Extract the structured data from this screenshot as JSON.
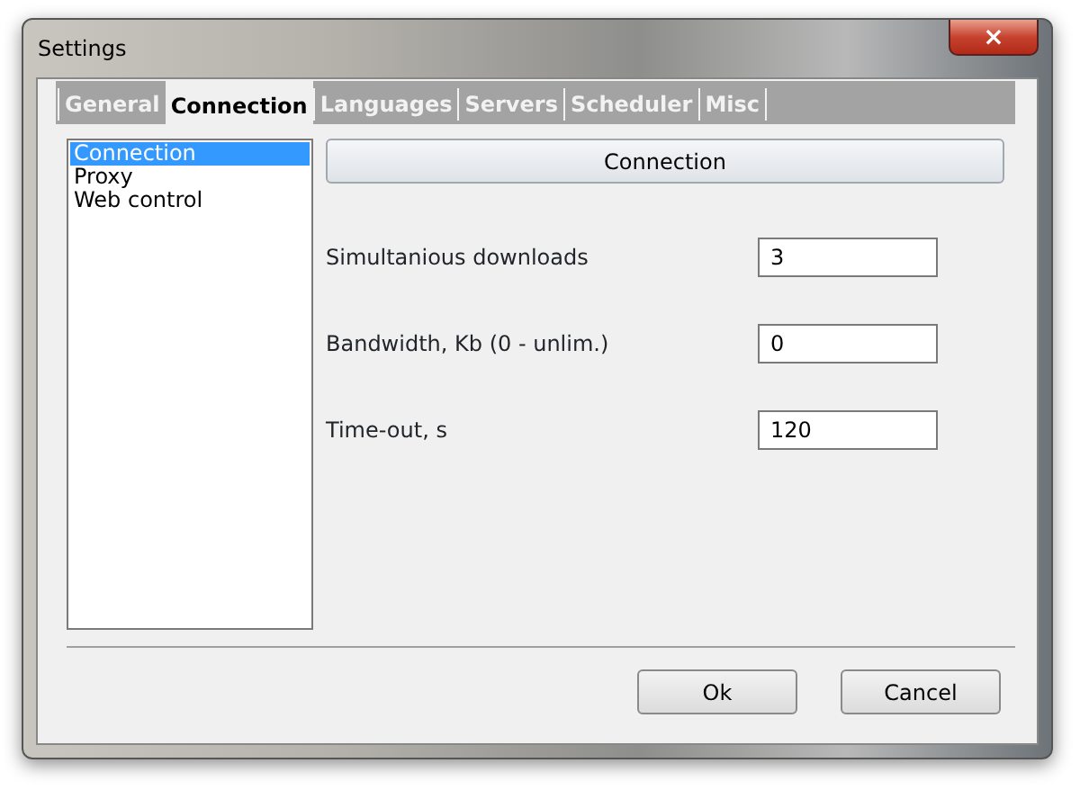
{
  "window": {
    "title": "Settings",
    "close_label": "×"
  },
  "tabs": [
    {
      "label": "General",
      "selected": false
    },
    {
      "label": "Connection",
      "selected": true
    },
    {
      "label": "Languages",
      "selected": false
    },
    {
      "label": "Servers",
      "selected": false
    },
    {
      "label": "Scheduler",
      "selected": false
    },
    {
      "label": "Misc",
      "selected": false
    }
  ],
  "sections": [
    {
      "label": "Connection",
      "selected": true
    },
    {
      "label": "Proxy",
      "selected": false
    },
    {
      "label": "Web control",
      "selected": false
    }
  ],
  "panel": {
    "header": "Connection",
    "fields": [
      {
        "label": "Simultanious downloads",
        "value": "3"
      },
      {
        "label": "Bandwidth, Kb (0 - unlim.)",
        "value": "0"
      },
      {
        "label": "Time-out, s",
        "value": "120"
      }
    ]
  },
  "buttons": [
    {
      "label": "Ok"
    },
    {
      "label": "Cancel"
    }
  ]
}
